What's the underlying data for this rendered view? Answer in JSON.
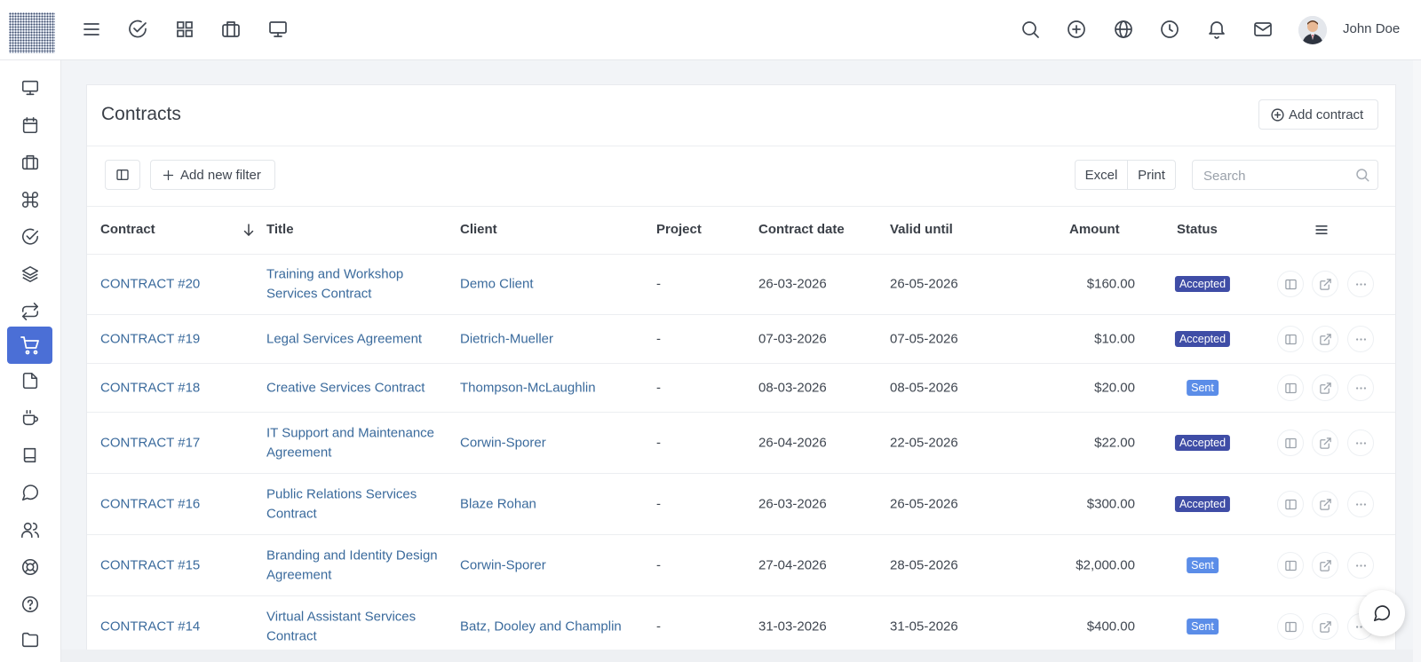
{
  "topbar": {
    "user_name": "John Doe",
    "left_icons": [
      "menu-icon",
      "check-circle-icon",
      "grid-icon",
      "briefcase-icon",
      "monitor-icon"
    ],
    "right_icons": [
      "search-icon",
      "plus-circle-icon",
      "globe-icon",
      "clock-icon",
      "bell-icon",
      "mail-icon"
    ]
  },
  "sidebar": {
    "active": "cart-icon",
    "items": [
      "monitor-icon",
      "calendar-icon",
      "briefcase-icon",
      "command-icon",
      "check-circle-icon",
      "layers-icon",
      "repeat-icon",
      "cart-icon",
      "file-icon",
      "coffee-icon",
      "book-icon",
      "message-circle-icon",
      "users-icon",
      "life-buoy-icon",
      "help-circle-icon",
      "folder-icon"
    ]
  },
  "page": {
    "title": "Contracts",
    "add_button": "Add contract"
  },
  "toolbar": {
    "add_filter": "Add new filter",
    "excel": "Excel",
    "print": "Print",
    "search_placeholder": "Search"
  },
  "table": {
    "headers": {
      "contract": "Contract",
      "title": "Title",
      "client": "Client",
      "project": "Project",
      "contract_date": "Contract date",
      "valid_until": "Valid until",
      "amount": "Amount",
      "status": "Status"
    },
    "rows": [
      {
        "contract": "CONTRACT #20",
        "title": "Training and Workshop Services Contract",
        "client": "Demo Client",
        "project": "-",
        "contract_date": "26-03-2026",
        "valid_until": "26-05-2026",
        "amount": "$160.00",
        "status": "Accepted"
      },
      {
        "contract": "CONTRACT #19",
        "title": "Legal Services Agreement",
        "client": "Dietrich-Mueller",
        "project": "-",
        "contract_date": "07-03-2026",
        "valid_until": "07-05-2026",
        "amount": "$10.00",
        "status": "Accepted"
      },
      {
        "contract": "CONTRACT #18",
        "title": "Creative Services Contract",
        "client": "Thompson-McLaughlin",
        "project": "-",
        "contract_date": "08-03-2026",
        "valid_until": "08-05-2026",
        "amount": "$20.00",
        "status": "Sent"
      },
      {
        "contract": "CONTRACT #17",
        "title": "IT Support and Maintenance Agreement",
        "client": "Corwin-Sporer",
        "project": "-",
        "contract_date": "26-04-2026",
        "valid_until": "22-05-2026",
        "amount": "$22.00",
        "status": "Accepted"
      },
      {
        "contract": "CONTRACT #16",
        "title": "Public Relations Services Contract",
        "client": "Blaze Rohan",
        "project": "-",
        "contract_date": "26-03-2026",
        "valid_until": "26-05-2026",
        "amount": "$300.00",
        "status": "Accepted"
      },
      {
        "contract": "CONTRACT #15",
        "title": "Branding and Identity Design Agreement",
        "client": "Corwin-Sporer",
        "project": "-",
        "contract_date": "27-04-2026",
        "valid_until": "28-05-2026",
        "amount": "$2,000.00",
        "status": "Sent"
      },
      {
        "contract": "CONTRACT #14",
        "title": "Virtual Assistant Services Contract",
        "client": "Batz, Dooley and Champlin",
        "project": "-",
        "contract_date": "31-03-2026",
        "valid_until": "31-05-2026",
        "amount": "$400.00",
        "status": "Sent"
      }
    ]
  },
  "colors": {
    "accepted": "#3f4da6",
    "sent": "#5b8de8",
    "active_nav": "#4b6fd6",
    "link": "#3a6a9c"
  }
}
